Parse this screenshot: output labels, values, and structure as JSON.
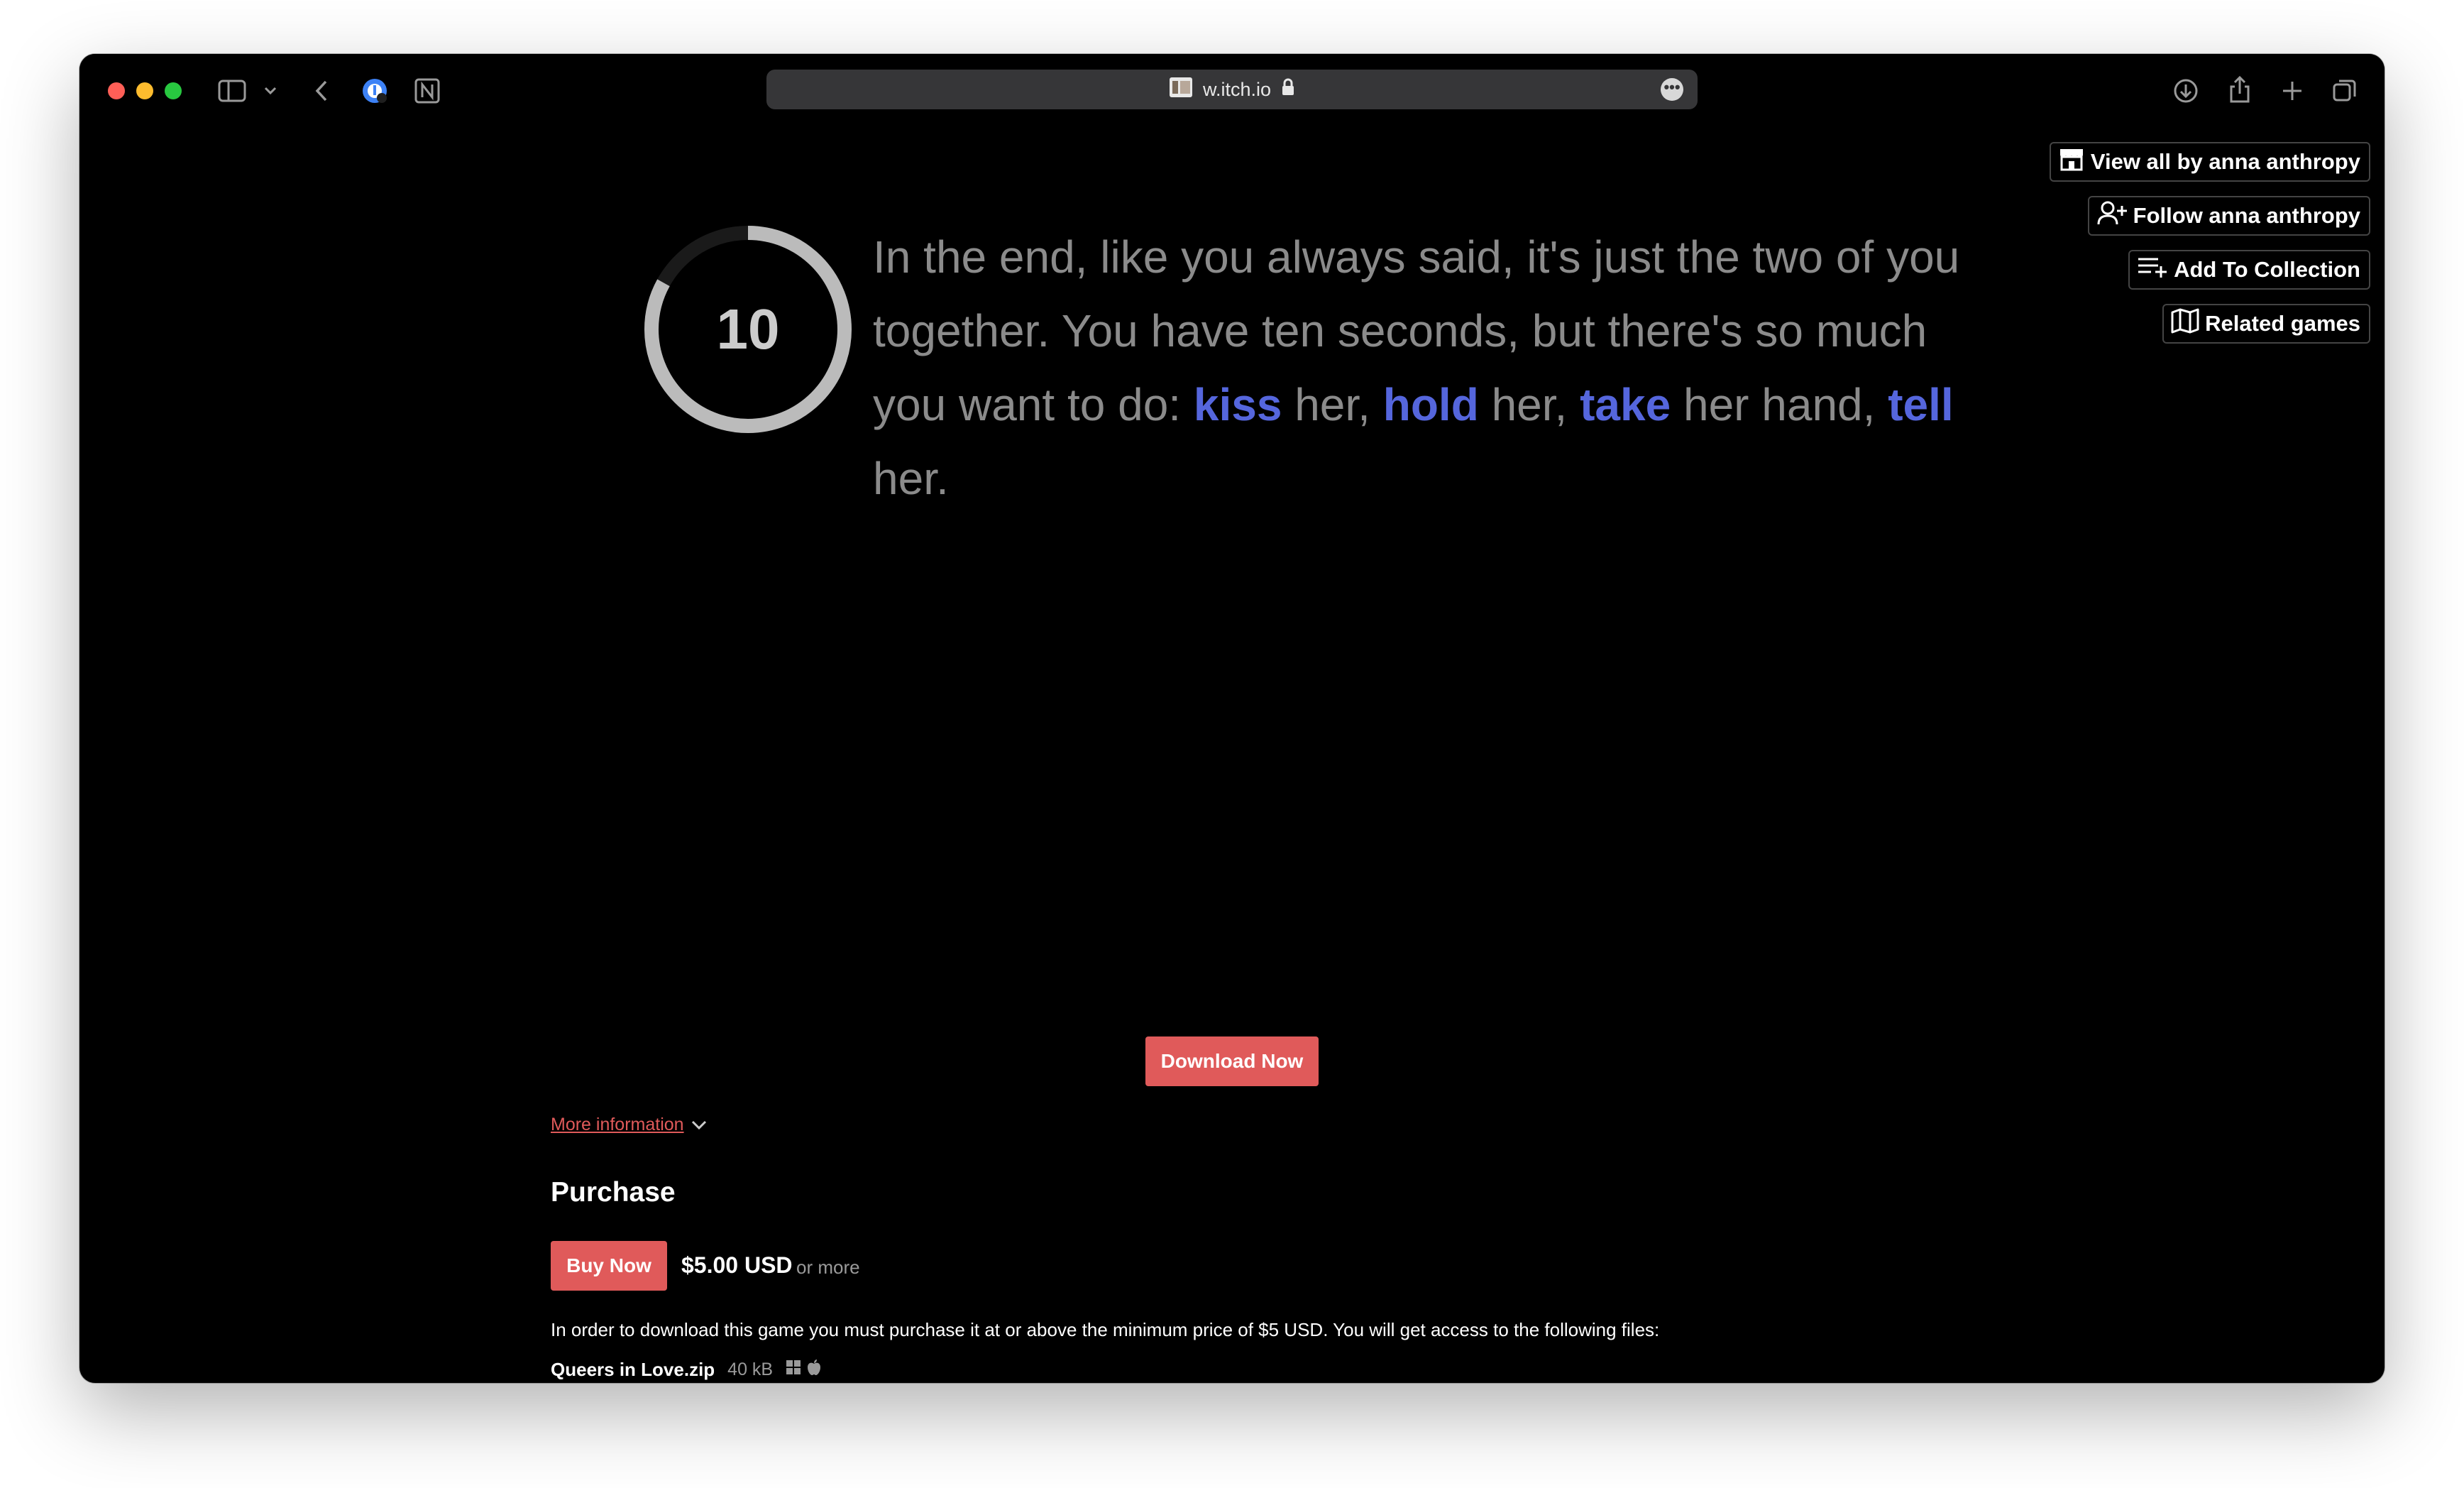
{
  "browser": {
    "url": "w.itch.io",
    "lock": "🔒",
    "more": "•••"
  },
  "timer": {
    "value": "10",
    "progress": 0.83
  },
  "story": {
    "p1": "In the end, like you always said, it's just the two of you together. You have ten seconds, but there's so much you want to do: ",
    "kw1": "kiss",
    "t1": " her, ",
    "kw2": "hold",
    "t2": " her, ",
    "kw3": "take",
    "t3": " her hand, ",
    "kw4": "tell",
    "t4": " her."
  },
  "sidebar": {
    "view_all": "View all by anna anthropy",
    "follow": "Follow anna anthropy",
    "add_collection": "Add To Collection",
    "related": "Related games"
  },
  "download_button": "Download Now",
  "more_info": "More information",
  "purchase": {
    "heading": "Purchase",
    "buy_button": "Buy Now",
    "price": "$5.00 USD",
    "price_suffix": "or more",
    "notice": "In order to download this game you must purchase it at or above the minimum price of $5 USD. You will get access to the following files:",
    "file_name": "Queers in Love.zip",
    "file_size": "40 kB"
  },
  "colors": {
    "accent": "#e05a5a",
    "keyword": "#5566dd",
    "story_text": "#8b8b8b",
    "background": "#000000"
  },
  "icons": [
    "sidebar-toggle-icon",
    "chevron-down-icon",
    "back-icon",
    "password-extension-icon",
    "notion-icon",
    "site-favicon",
    "lock-icon",
    "more-icon",
    "download-icon",
    "share-icon",
    "new-tab-icon",
    "tabs-overview-icon",
    "store-icon",
    "add-user-icon",
    "playlist-add-icon",
    "map-icon",
    "windows-icon",
    "apple-icon"
  ]
}
